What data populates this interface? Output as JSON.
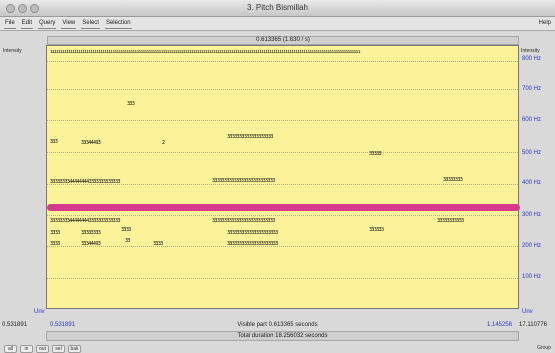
{
  "window": {
    "title": "3. Pitch Bismillah"
  },
  "menu": {
    "items": [
      "File",
      "Edit",
      "Query",
      "View",
      "Select",
      "Selection"
    ],
    "help": "Help"
  },
  "cursor_readout": "0.613365 (1.630 / s)",
  "plot": {
    "left_label": "Intensity",
    "right_label": "Intensity",
    "frequency_labels": [
      {
        "label": "800 Hz",
        "value": 800
      },
      {
        "label": "700 Hz",
        "value": 700
      },
      {
        "label": "600 Hz",
        "value": 600
      },
      {
        "label": "500 Hz",
        "value": 500
      },
      {
        "label": "400 Hz",
        "value": 400
      },
      {
        "label": "300 Hz",
        "value": 300
      },
      {
        "label": "200 Hz",
        "value": 200
      },
      {
        "label": "100 Hz",
        "value": 100
      }
    ],
    "unvoiced_left": "Unv",
    "unvoiced_right": "Unv"
  },
  "time_bar": {
    "window_start": "0.531891",
    "selection_start": "0.531891",
    "visible_part": "Visible part 0.613365 seconds",
    "selection_end": "1.145256",
    "window_end": "17.110776"
  },
  "total_duration": "Total duration 18.256032 seconds",
  "bottom_toolbar": {
    "buttons": [
      "all",
      "in",
      "out",
      "sel",
      "bak"
    ],
    "group_label": "Group"
  }
}
